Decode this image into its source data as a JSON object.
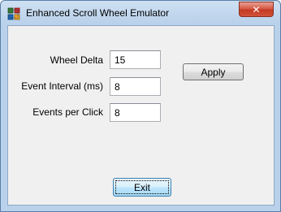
{
  "window": {
    "title": "Enhanced Scroll Wheel Emulator",
    "close_symbol": "✕",
    "icon": "app-icon"
  },
  "form": {
    "wheel_delta": {
      "label": "Wheel Delta",
      "value": "15"
    },
    "event_interval": {
      "label": "Event Interval (ms)",
      "value": "8"
    },
    "events_per_click": {
      "label": "Events per Click",
      "value": "8"
    }
  },
  "buttons": {
    "apply": "Apply",
    "exit": "Exit"
  }
}
